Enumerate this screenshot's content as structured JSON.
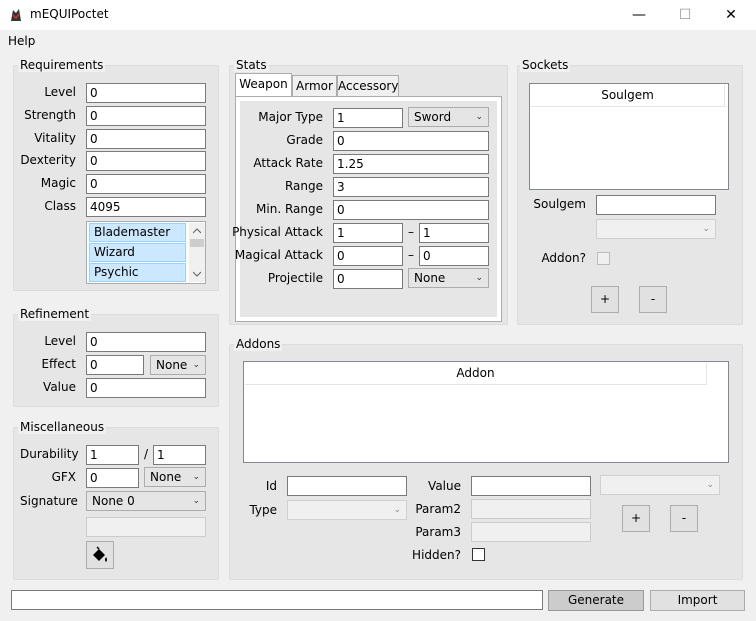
{
  "window": {
    "title": "mEQUIPoctet",
    "minimize": "—",
    "maximize": "☐",
    "close": "✕"
  },
  "menu": {
    "help": "Help"
  },
  "requirements": {
    "title": "Requirements",
    "level_label": "Level",
    "level": "0",
    "strength_label": "Strength",
    "strength": "0",
    "vitality_label": "Vitality",
    "vitality": "0",
    "dexterity_label": "Dexterity",
    "dexterity": "0",
    "magic_label": "Magic",
    "magic": "0",
    "class_label": "Class",
    "class_value": "4095",
    "class_list": [
      "Blademaster",
      "Wizard",
      "Psychic"
    ]
  },
  "refinement": {
    "title": "Refinement",
    "level_label": "Level",
    "level": "0",
    "effect_label": "Effect",
    "effect": "0",
    "effect_type": "None",
    "value_label": "Value",
    "value": "0"
  },
  "misc": {
    "title": "Miscellaneous",
    "durability_label": "Durability",
    "durability": "1",
    "slash": "/",
    "durability_max": "1",
    "gfx_label": "GFX",
    "gfx": "0",
    "gfx_type": "None",
    "signature_label": "Signature",
    "signature": "None 0",
    "signature_text": ""
  },
  "stats": {
    "title": "Stats",
    "tabs": [
      "Weapon",
      "Armor",
      "Accessory"
    ],
    "major_type_label": "Major Type",
    "major_type": "1",
    "major_type_name": "Sword",
    "grade_label": "Grade",
    "grade": "0",
    "attack_rate_label": "Attack Rate",
    "attack_rate": "1.25",
    "range_label": "Range",
    "range": "3",
    "min_range_label": "Min. Range",
    "min_range": "0",
    "physical_label": "Physical Attack",
    "physical_min": "1",
    "physical_max": "1",
    "magical_label": "Magical Attack",
    "magical_min": "0",
    "magical_max": "0",
    "projectile_label": "Projectile",
    "projectile": "0",
    "projectile_type": "None",
    "dash": "–"
  },
  "sockets": {
    "title": "Sockets",
    "column": "Soulgem",
    "soulgem_label": "Soulgem",
    "soulgem": "",
    "addon_label": "Addon?",
    "add": "+",
    "remove": "-"
  },
  "addons": {
    "title": "Addons",
    "column": "Addon",
    "id_label": "Id",
    "id": "",
    "type_label": "Type",
    "value_label": "Value",
    "value": "",
    "param2_label": "Param2",
    "param3_label": "Param3",
    "hidden_label": "Hidden?",
    "add": "+",
    "remove": "-"
  },
  "bottom": {
    "output": "",
    "generate": "Generate",
    "import": "Import"
  }
}
